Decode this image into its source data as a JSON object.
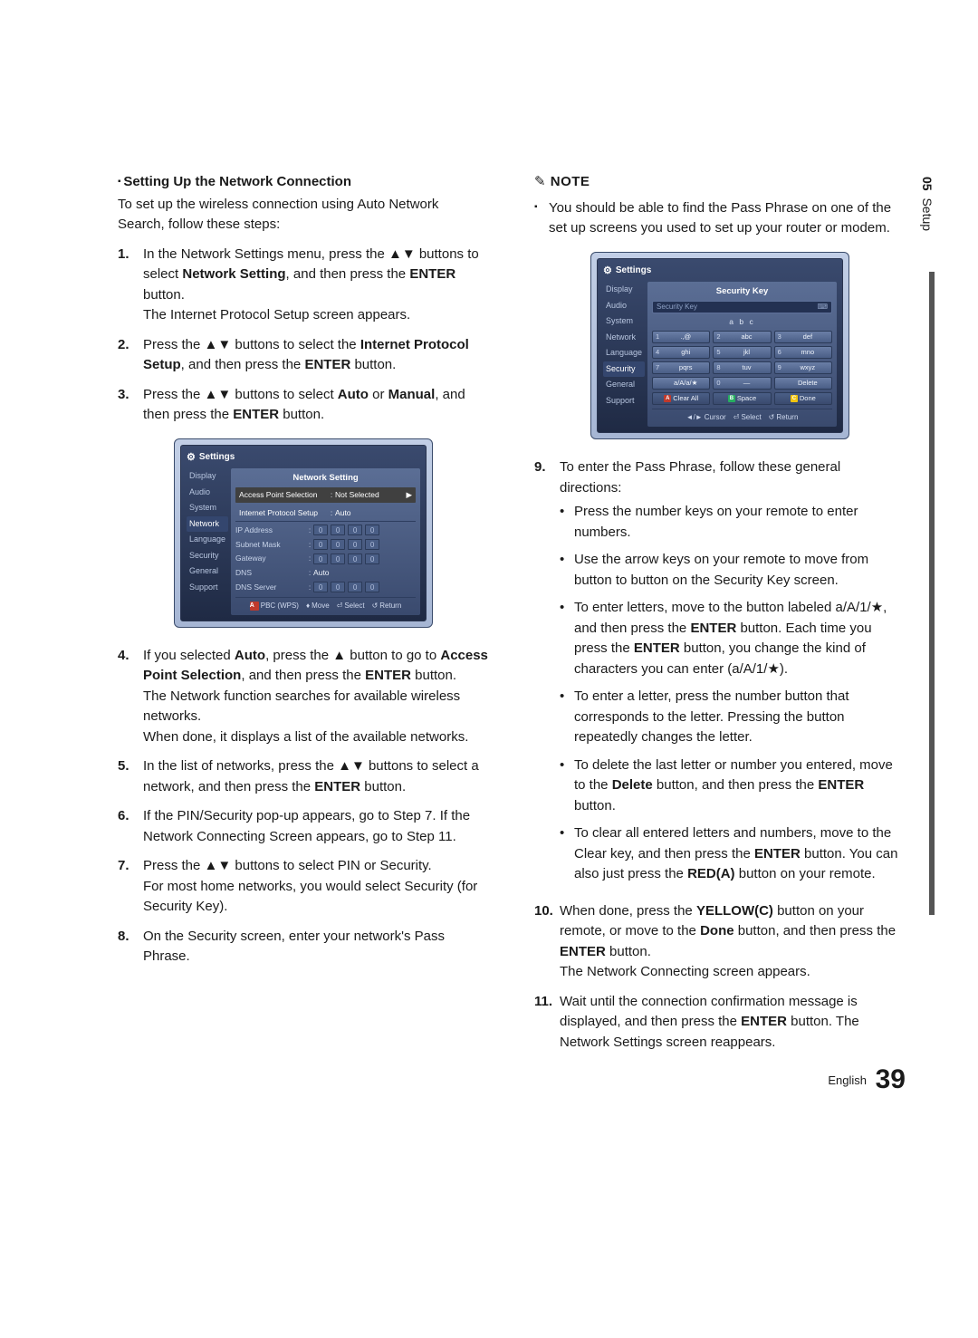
{
  "side_tab": {
    "num": "05",
    "label": "Setup"
  },
  "footer": {
    "lang": "English",
    "page": "39"
  },
  "left": {
    "heading": "Setting Up the Network Connection",
    "intro": "To set up the wireless connection using Auto Network Search, follow these steps:",
    "steps": [
      {
        "n": "1.",
        "lines": [
          {
            "t": "In the Network Settings menu, press the ▲▼ buttons to select "
          },
          {
            "b": "Network Setting"
          },
          {
            "t": ", and then press the "
          },
          {
            "b": "ENTER"
          },
          {
            "t": " button."
          },
          {
            "br": true
          },
          {
            "t": "The Internet Protocol Setup screen appears."
          }
        ]
      },
      {
        "n": "2.",
        "lines": [
          {
            "t": "Press the ▲▼ buttons to select the "
          },
          {
            "b": "Internet Protocol Setup"
          },
          {
            "t": ", and then press the "
          },
          {
            "b": "ENTER"
          },
          {
            "t": " button."
          }
        ]
      },
      {
        "n": "3.",
        "lines": [
          {
            "t": "Press the ▲▼ buttons to select "
          },
          {
            "b": "Auto"
          },
          {
            "t": " or "
          },
          {
            "b": "Manual"
          },
          {
            "t": ", and then press the "
          },
          {
            "b": "ENTER"
          },
          {
            "t": " button."
          }
        ]
      },
      {
        "n": "4.",
        "lines": [
          {
            "t": "If you selected "
          },
          {
            "b": "Auto"
          },
          {
            "t": ", press the ▲ button to go to "
          },
          {
            "b": "Access Point Selection"
          },
          {
            "t": ", and then press the "
          },
          {
            "b": "ENTER"
          },
          {
            "t": " button."
          },
          {
            "br": true
          },
          {
            "t": "The Network function searches for available wireless networks."
          },
          {
            "br": true
          },
          {
            "t": "When done, it displays a list of the available networks."
          }
        ]
      },
      {
        "n": "5.",
        "lines": [
          {
            "t": "In the list of networks, press the ▲▼ buttons to select a network, and then press the "
          },
          {
            "b": "ENTER"
          },
          {
            "t": " button."
          }
        ]
      },
      {
        "n": "6.",
        "lines": [
          {
            "t": "If the PIN/Security pop-up appears, go to Step 7. If the Network Connecting Screen appears, go to Step 11."
          }
        ]
      },
      {
        "n": "7.",
        "lines": [
          {
            "t": "Press the ▲▼ buttons to select PIN or Security."
          },
          {
            "br": true
          },
          {
            "t": "For most home networks, you would select Security (for Security Key)."
          }
        ]
      },
      {
        "n": "8.",
        "lines": [
          {
            "t": "On the Security screen, enter your network's Pass Phrase."
          }
        ]
      }
    ]
  },
  "right": {
    "note_head": "NOTE",
    "note_item": "You should be able to find the Pass Phrase on one of the set up screens you used to set up your router or modem.",
    "steps": [
      {
        "n": "9.",
        "lines": [
          {
            "t": "To enter the Pass Phrase, follow these general directions:"
          }
        ],
        "bullets": [
          [
            {
              "t": "Press the number keys on your remote to enter numbers."
            }
          ],
          [
            {
              "t": "Use the arrow keys on your remote to move from button to button on the Security Key screen."
            }
          ],
          [
            {
              "t": "To enter letters, move to the button labeled a/A/1/★, and then press the "
            },
            {
              "b": "ENTER"
            },
            {
              "t": " button. Each time you press the "
            },
            {
              "b": "ENTER"
            },
            {
              "t": " button, you change the kind of characters you can enter (a/A/1/★)."
            }
          ],
          [
            {
              "t": "To enter a letter, press the number button that corresponds to the letter. Pressing the button repeatedly changes the letter."
            }
          ],
          [
            {
              "t": "To delete the last letter or number you entered, move to the "
            },
            {
              "b": "Delete"
            },
            {
              "t": " button, and then press the "
            },
            {
              "b": "ENTER"
            },
            {
              "t": " button."
            }
          ],
          [
            {
              "t": "To clear all entered letters and numbers, move to the Clear key, and then press the "
            },
            {
              "b": "ENTER"
            },
            {
              "t": " button. You can also just press the "
            },
            {
              "b": "RED(A)"
            },
            {
              "t": " button on your remote."
            }
          ]
        ]
      },
      {
        "n": "10.",
        "lines": [
          {
            "t": "When done, press the "
          },
          {
            "b": "YELLOW(C)"
          },
          {
            "t": " button on your remote, or move to the "
          },
          {
            "b": "Done"
          },
          {
            "t": " button, and then press the "
          },
          {
            "b": "ENTER"
          },
          {
            "t": " button."
          },
          {
            "br": true
          },
          {
            "t": "The Network Connecting screen appears."
          }
        ]
      },
      {
        "n": "11.",
        "lines": [
          {
            "t": "Wait until the connection confirmation message is displayed, and then press the "
          },
          {
            "b": "ENTER"
          },
          {
            "t": " button. The Network Settings screen reappears."
          }
        ]
      }
    ]
  },
  "shot1": {
    "win": "Settings",
    "tabs": [
      "Display",
      "Audio",
      "System",
      "Network",
      "Language",
      "Security",
      "General",
      "Support"
    ],
    "panel_title": "Network Setting",
    "ap_label": "Access Point Selection",
    "ap_value": "Not Selected",
    "ip_label": "Internet Protocol Setup",
    "ip_value": "Auto",
    "rows": [
      {
        "l": "IP Address",
        "boxes": [
          "0",
          "0",
          "0",
          "0"
        ]
      },
      {
        "l": "Subnet Mask",
        "boxes": [
          "0",
          "0",
          "0",
          "0"
        ]
      },
      {
        "l": "Gateway",
        "boxes": [
          "0",
          "0",
          "0",
          "0"
        ]
      }
    ],
    "dns_label": "DNS",
    "dns_value": "Auto",
    "dnss_label": "DNS Server",
    "dnss_boxes": [
      "0",
      "0",
      "0",
      "0"
    ],
    "guide": {
      "a": "PBC (WPS)",
      "move": "Move",
      "select": "Select",
      "ret": "Return"
    }
  },
  "shot2": {
    "win": "Settings",
    "tabs": [
      "Display",
      "Audio",
      "System",
      "Network",
      "Language",
      "Security",
      "General",
      "Support"
    ],
    "panel_title": "Security Key",
    "placeholder": "Security Key",
    "abc": "a  b  c",
    "keys": [
      {
        "n": "1",
        "l": ".,@"
      },
      {
        "n": "2",
        "l": "abc"
      },
      {
        "n": "3",
        "l": "def"
      },
      {
        "n": "4",
        "l": "ghi"
      },
      {
        "n": "5",
        "l": "jkl"
      },
      {
        "n": "6",
        "l": "mno"
      },
      {
        "n": "7",
        "l": "pqrs"
      },
      {
        "n": "8",
        "l": "tuv"
      },
      {
        "n": "9",
        "l": "wxyz"
      },
      {
        "n": "",
        "l": "a/A/a/★"
      },
      {
        "n": "0",
        "l": "—"
      },
      {
        "n": "",
        "l": "Delete"
      }
    ],
    "bottom": [
      "Clear All",
      "Space",
      "Done"
    ],
    "guide": {
      "cursor": "Cursor",
      "select": "Select",
      "ret": "Return"
    }
  }
}
